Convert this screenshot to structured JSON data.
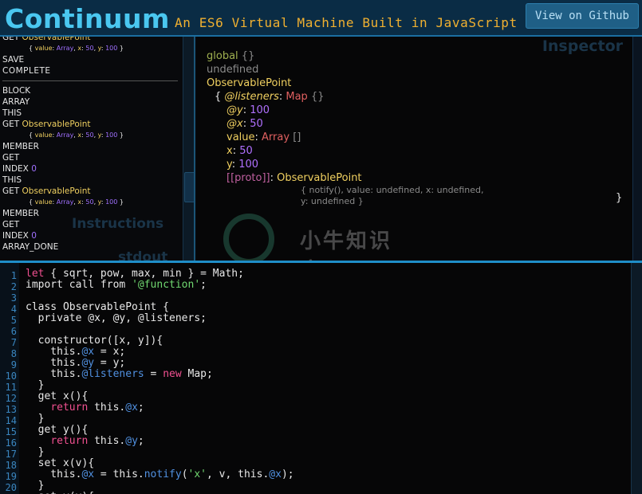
{
  "header": {
    "logo": "Continuum",
    "tagline": "An ES6 Virtual Machine Built in JavaScript",
    "github_label": "View on Github"
  },
  "instructions": {
    "label": "Instructions",
    "items": [
      {
        "op": "GET",
        "arg": "ObservablePoint",
        "type": "get",
        "sub": {
          "k1": "value",
          "v1": "Array",
          "k2": "x",
          "v2": "50",
          "k3": "y",
          "v3": "100"
        }
      },
      {
        "op": "SAVE",
        "type": "plain"
      },
      {
        "op": "COMPLETE",
        "type": "complete"
      },
      {
        "op": "BLOCK",
        "type": "plain"
      },
      {
        "op": "ARRAY",
        "type": "plain"
      },
      {
        "op": "THIS",
        "type": "this"
      },
      {
        "op": "GET",
        "arg": "ObservablePoint",
        "type": "get",
        "sub": {
          "k1": "value",
          "v1": "Array",
          "k2": "x",
          "v2": "50",
          "k3": "y",
          "v3": "100"
        }
      },
      {
        "op": "MEMBER",
        "type": "plain"
      },
      {
        "op": "GET",
        "type": "plain"
      },
      {
        "op": "INDEX",
        "num": "0",
        "type": "index"
      },
      {
        "op": "THIS",
        "type": "this"
      },
      {
        "op": "GET",
        "arg": "ObservablePoint",
        "type": "get",
        "sub": {
          "k1": "value",
          "v1": "Array",
          "k2": "x",
          "v2": "50",
          "k3": "y",
          "v3": "100"
        }
      },
      {
        "op": "MEMBER",
        "type": "plain"
      },
      {
        "op": "GET",
        "type": "plain"
      },
      {
        "op": "INDEX",
        "num": "0",
        "type": "index"
      },
      {
        "op": "ARRAY_DONE",
        "type": "plain"
      }
    ]
  },
  "stdout": {
    "label": "stdout"
  },
  "inspector": {
    "label": "Inspector",
    "global_label": "global",
    "global_braces": "{}",
    "undefined_text": "undefined",
    "object_name": "ObservablePoint",
    "listeners_key": "@listeners",
    "listeners_type": "Map",
    "listeners_braces": "{}",
    "y_private_key": "@y",
    "y_private_val": "100",
    "x_private_key": "@x",
    "x_private_val": "50",
    "value_key": "value",
    "value_type": "Array",
    "value_braces": "[]",
    "x_key": "x",
    "x_val": "50",
    "y_key": "y",
    "y_val": "100",
    "proto_key": "[[proto]]",
    "proto_name": "ObservablePoint",
    "proto_sub_line1": "{ notify(), value: undefined, x: undefined,",
    "proto_sub_line2": "y: undefined }",
    "closing_brace": "}"
  },
  "watermark": {
    "text": "小牛知识库"
  },
  "editor": {
    "line_numbers": [
      "1",
      "2",
      "3",
      "4",
      "5",
      "6",
      "7",
      "8",
      "9",
      "10",
      "11",
      "12",
      "13",
      "14",
      "15",
      "16",
      "17",
      "18",
      "19",
      "20"
    ]
  },
  "colors": {
    "header_bg": "#0a2c45",
    "logo": "#4ac7f0",
    "tagline": "#f0b030",
    "accent_divider": "#1f8ec8",
    "keyword": "#f05090",
    "string": "#70d870",
    "private_name": "#5090e0"
  }
}
